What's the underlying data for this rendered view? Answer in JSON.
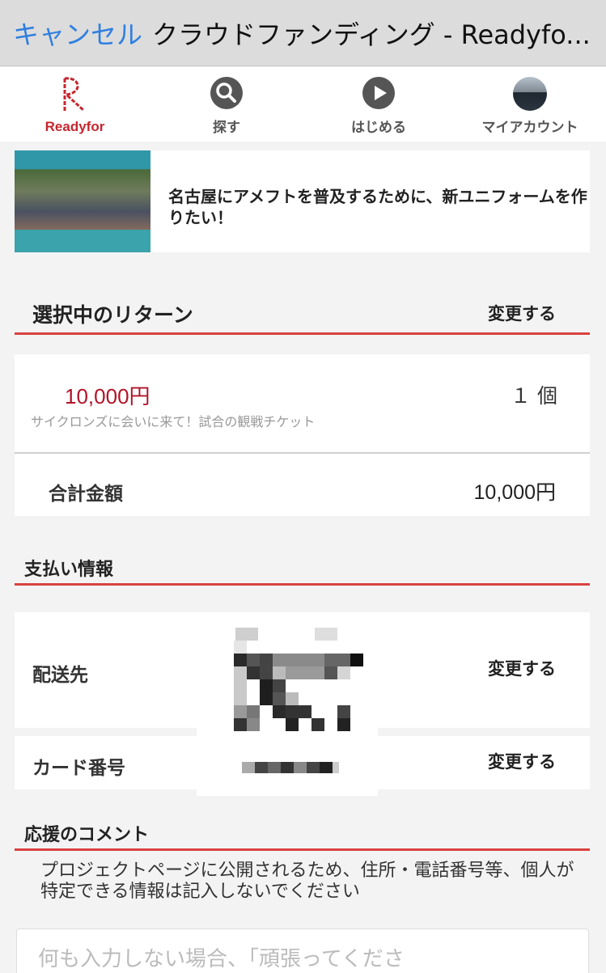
{
  "topbar": {
    "cancel_label": "キャンセル",
    "title": "クラウドファンディング - Readyfo..."
  },
  "nav": {
    "logo_text": "Readyfor",
    "items": [
      {
        "label": "探す",
        "icon": "search-icon"
      },
      {
        "label": "はじめる",
        "icon": "play-icon"
      },
      {
        "label": "マイアカウント",
        "icon": "avatar"
      }
    ]
  },
  "project": {
    "title": "名古屋にアメフトを普及するために、新ユニフォームを作りたい！"
  },
  "selected_return": {
    "heading": "選択中のリターン",
    "change_label": "変更する",
    "price": "10,000円",
    "description": "サイクロンズに会いに来て！試合の観戦チケット",
    "quantity": "１ 個",
    "total_label": "合計金額",
    "total_value": "10,000円"
  },
  "payment": {
    "heading": "支払い情報",
    "shipping_label": "配送先",
    "shipping_change": "変更する",
    "card_label": "カード番号",
    "card_change": "変更する"
  },
  "comment": {
    "heading": "応援のコメント",
    "note": "プロジェクトページに公開されるため、住所・電話番号等、個人が特定できる情報は記入しないでください",
    "placeholder": "何も入力しない場合、「頑張ってくださ"
  },
  "colors": {
    "accent_red": "#d9423f",
    "price_red": "#b3142a",
    "link_blue": "#2f7fe0"
  }
}
